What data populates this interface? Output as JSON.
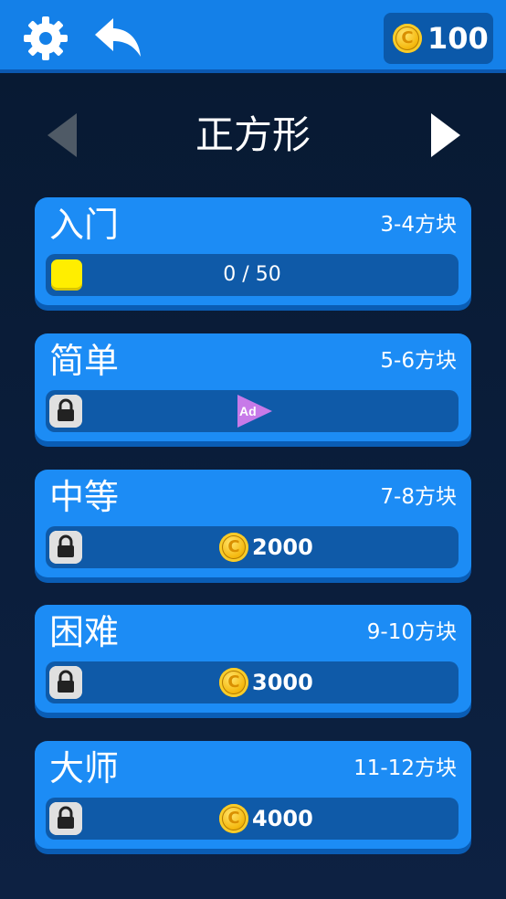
{
  "header": {
    "coins": "100"
  },
  "category": {
    "title": "正方形"
  },
  "levels": [
    {
      "name": "入门",
      "range": "3-4方块",
      "progress": "0 / 50"
    },
    {
      "name": "简单",
      "range": "5-6方块",
      "unlock": "Ad"
    },
    {
      "name": "中等",
      "range": "7-8方块",
      "price": "2000"
    },
    {
      "name": "困难",
      "range": "9-10方块",
      "price": "3000"
    },
    {
      "name": "大师",
      "range": "11-12方块",
      "price": "4000"
    }
  ],
  "colors": {
    "topbar": "#1480e8",
    "card": "#1c8cf5",
    "bar": "#0f5aa8",
    "accent": "#ffee00"
  }
}
